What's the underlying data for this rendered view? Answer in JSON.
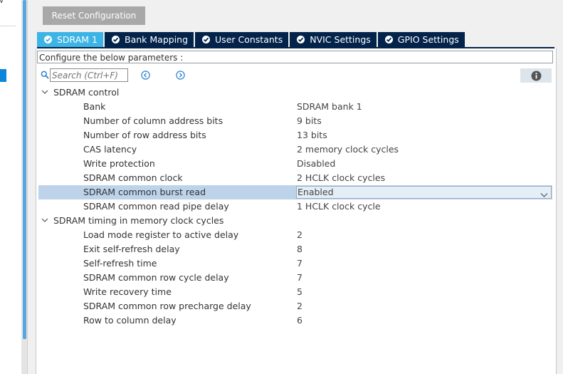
{
  "toolbar": {
    "reset_label": "Reset Configuration"
  },
  "tabs": [
    {
      "label": "SDRAM 1",
      "active": true,
      "icon": "check-circle-icon"
    },
    {
      "label": "Bank Mapping",
      "active": false,
      "icon": "check-circle-icon"
    },
    {
      "label": "User Constants",
      "active": false,
      "icon": "check-circle-icon"
    },
    {
      "label": "NVIC Settings",
      "active": false,
      "icon": "check-circle-icon"
    },
    {
      "label": "GPIO Settings",
      "active": false,
      "icon": "check-circle-icon"
    }
  ],
  "config_label": "Configure the below parameters :",
  "search": {
    "placeholder": "Search (Ctrl+F)",
    "value": ""
  },
  "groups": [
    {
      "title": "SDRAM control",
      "params": [
        {
          "name": "Bank",
          "value": "SDRAM bank 1"
        },
        {
          "name": "Number of column address bits",
          "value": "9 bits"
        },
        {
          "name": "Number of row address bits",
          "value": "13 bits"
        },
        {
          "name": "CAS latency",
          "value": "2 memory clock cycles"
        },
        {
          "name": "Write protection",
          "value": "Disabled"
        },
        {
          "name": "SDRAM common clock",
          "value": "2 HCLK clock cycles"
        },
        {
          "name": "SDRAM common burst read",
          "value": "Enabled"
        },
        {
          "name": "SDRAM common read pipe delay",
          "value": "1 HCLK clock cycle"
        }
      ]
    },
    {
      "title": "SDRAM timing in memory clock cycles",
      "params": [
        {
          "name": "Load mode register to active delay",
          "value": "2"
        },
        {
          "name": "Exit self-refresh delay",
          "value": "8"
        },
        {
          "name": "Self-refresh time",
          "value": "7"
        },
        {
          "name": "SDRAM common row cycle delay",
          "value": "7"
        },
        {
          "name": "Write recovery time",
          "value": "5"
        },
        {
          "name": "SDRAM common row precharge delay",
          "value": "2"
        },
        {
          "name": "Row to column delay",
          "value": "6"
        }
      ]
    }
  ],
  "colors": {
    "tab_active": "#3cb4e6",
    "tab_inactive": "#03234b",
    "selected_row": "#bcd3ea",
    "reset_button": "#a8a8a8"
  }
}
